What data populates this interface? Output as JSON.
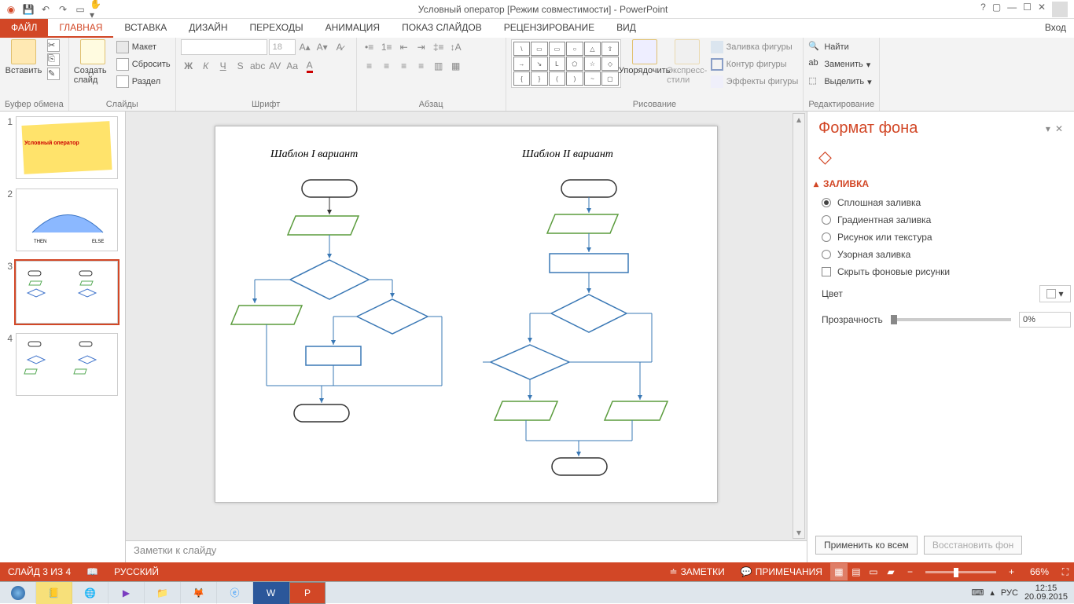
{
  "window": {
    "title": "Условный оператор [Режим совместимости] - PowerPoint"
  },
  "tabs": {
    "file": "ФАЙЛ",
    "home": "ГЛАВНАЯ",
    "insert": "ВСТАВКА",
    "design": "ДИЗАЙН",
    "transitions": "ПЕРЕХОДЫ",
    "animation": "АНИМАЦИЯ",
    "slideshow": "ПОКАЗ СЛАЙДОВ",
    "review": "РЕЦЕНЗИРОВАНИЕ",
    "view": "ВИД",
    "signin": "Вход"
  },
  "ribbon": {
    "clipboard": {
      "paste": "Вставить",
      "label": "Буфер обмена"
    },
    "slides": {
      "new": "Создать слайд",
      "layout": "Макет",
      "reset": "Сбросить",
      "section": "Раздел",
      "label": "Слайды"
    },
    "font": {
      "label": "Шрифт",
      "size": "18"
    },
    "para": {
      "label": "Абзац"
    },
    "drawing": {
      "arrange": "Упорядочить",
      "styles": "Экспресс-стили",
      "fill": "Заливка фигуры",
      "outline": "Контур фигуры",
      "effects": "Эффекты фигуры",
      "label": "Рисование"
    },
    "editing": {
      "find": "Найти",
      "replace": "Заменить",
      "select": "Выделить",
      "label": "Редактирование"
    }
  },
  "slide": {
    "title1": "Шаблон I вариант",
    "title2": "Шаблон II вариант"
  },
  "notes_placeholder": "Заметки к слайду",
  "pane": {
    "title": "Формат фона",
    "section": "ЗАЛИВКА",
    "r_solid": "Сплошная заливка",
    "r_grad": "Градиентная заливка",
    "r_pic": "Рисунок или текстура",
    "r_patt": "Узорная заливка",
    "hide_bg": "Скрыть фоновые рисунки",
    "color": "Цвет",
    "transp": "Прозрачность",
    "transp_val": "0%",
    "apply_all": "Применить ко всем",
    "reset_bg": "Восстановить фон"
  },
  "status": {
    "slide": "СЛАЙД 3 ИЗ 4",
    "lang": "РУССКИЙ",
    "notes": "ЗАМЕТКИ",
    "comments": "ПРИМЕЧАНИЯ",
    "zoom": "66%"
  },
  "tray": {
    "kb": "РУС",
    "time": "12:15",
    "date": "20.09.2015"
  }
}
